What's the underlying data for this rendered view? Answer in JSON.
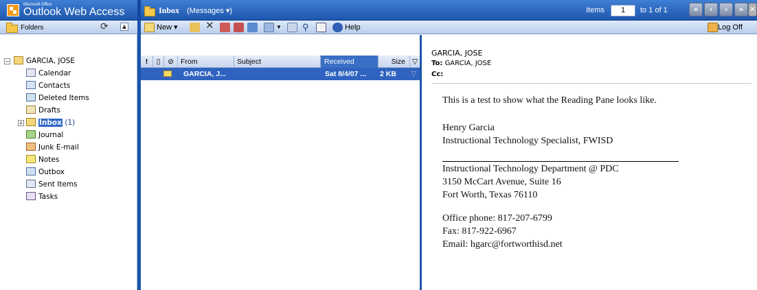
{
  "app": {
    "brand_small": "Microsoft Office",
    "brand_title": "Outlook Web Access"
  },
  "header": {
    "folder_title": "Inbox",
    "view_label": "(Messages ▾)",
    "items_label": "Items",
    "items_value": "1",
    "items_of": "to 1 of 1"
  },
  "toolbar": {
    "folders_label": "Folders",
    "new_label": "New ▾",
    "help_label": "Help",
    "logoff_label": "Log Off"
  },
  "tree": {
    "root": "GARCIA, JOSE",
    "items": [
      {
        "label": "Calendar"
      },
      {
        "label": "Contacts"
      },
      {
        "label": "Deleted Items"
      },
      {
        "label": "Drafts"
      },
      {
        "label": "Inbox",
        "count": "(1)"
      },
      {
        "label": "Journal"
      },
      {
        "label": "Junk E-mail"
      },
      {
        "label": "Notes"
      },
      {
        "label": "Outbox"
      },
      {
        "label": "Sent Items"
      },
      {
        "label": "Tasks"
      }
    ]
  },
  "list": {
    "columns": {
      "importance": "!",
      "type": "",
      "attachment": "",
      "from": "From",
      "subject": "Subject",
      "received": "Received",
      "size": "Size"
    },
    "rows": [
      {
        "from": "GARCIA, J...",
        "subject": "",
        "received": "Sat 8/4/07 ...",
        "size": "2 KB"
      }
    ]
  },
  "reading": {
    "from": "GARCIA, JOSE",
    "to_label": "To:",
    "to": "GARCIA, JOSE",
    "cc_label": "Cc:",
    "body": [
      "This is a test to show what the Reading Pane looks like.",
      "Henry Garcia",
      "Instructional Technology Specialist, FWISD",
      "Instructional Technology Department @ PDC",
      "3150 McCart Avenue, Suite 16",
      "Fort Worth, Texas 76110",
      "Office phone: 817-207-6799",
      "Fax: 817-922-6967",
      "Email: hgarc@fortworthisd.net"
    ]
  },
  "colors": {
    "header_blue": "#1e57ad",
    "selection_blue": "#2f63bf",
    "toolbar_light": "#dfeafa"
  }
}
